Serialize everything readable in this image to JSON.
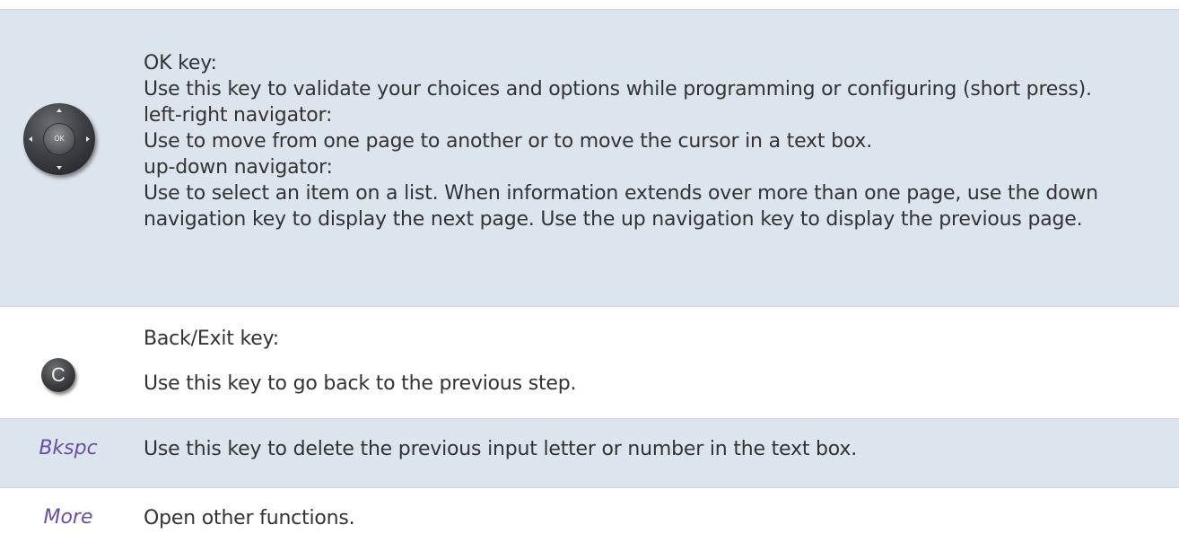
{
  "rows": [
    {
      "icon": "ok-navigation-key-icon",
      "ok_label": "OK",
      "lines": [
        "OK key:",
        "Use this key to validate your choices and options while programming or configuring (short press).",
        "left-right navigator:",
        "Use to move from one page to another or to move the cursor in a text box.",
        "up-down navigator:",
        "Use to select an item on a list. When information extends over more than one page, use the down",
        "navigation key to display the next page. Use the up navigation key to display the previous page."
      ]
    },
    {
      "icon": "back-exit-key-icon",
      "key_glyph": "C",
      "title": "Back/Exit key:",
      "description": "Use this key to go back to the previous step."
    },
    {
      "term": "Bkspc",
      "description": "Use this key to delete the previous input letter or number in the text box."
    },
    {
      "term": "More",
      "description": "Open other functions."
    }
  ],
  "colors": {
    "shaded_row": "#dce4ee",
    "term_text": "#6a4fa0",
    "body_text": "#333333"
  }
}
